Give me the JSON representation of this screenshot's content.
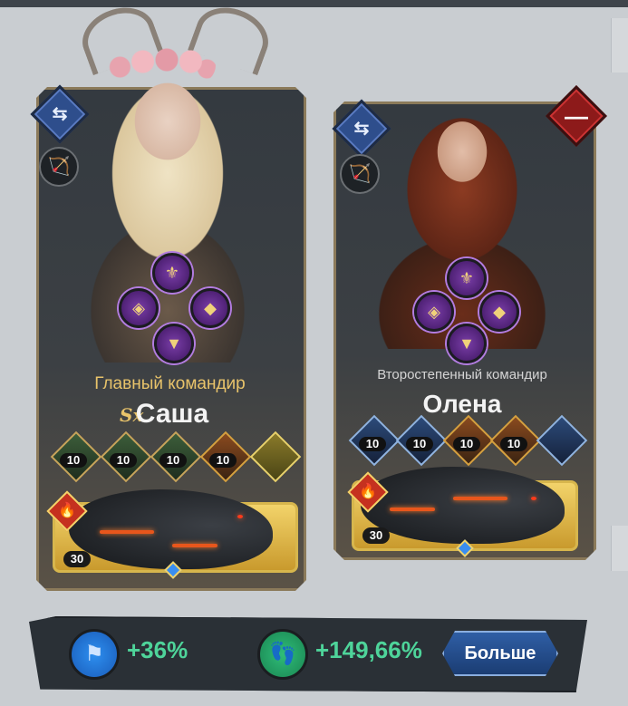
{
  "main_commander": {
    "rank": "Главный командир",
    "badge": "Sx",
    "name": "Саша",
    "skill_levels": [
      "10",
      "10",
      "10",
      "10"
    ],
    "pet_level": "30"
  },
  "secondary_commander": {
    "rank": "Второстепенный командир",
    "name": "Олена",
    "skill_levels": [
      "10",
      "10",
      "10",
      "10"
    ],
    "pet_level": "30"
  },
  "stats": {
    "march_bonus": "+36%",
    "speed_bonus": "+149,66%"
  },
  "more_button": "Больше",
  "icons": {
    "swap": "⇆",
    "bow": "🏹",
    "remove": "—",
    "fire": "🔥",
    "flag": "⚑",
    "foot": "👣"
  },
  "colors": {
    "gold": "#e8c36a",
    "green_stat": "#4ed49a",
    "blue_button": "#2f5ea5",
    "red_remove": "#8d1a1a"
  }
}
